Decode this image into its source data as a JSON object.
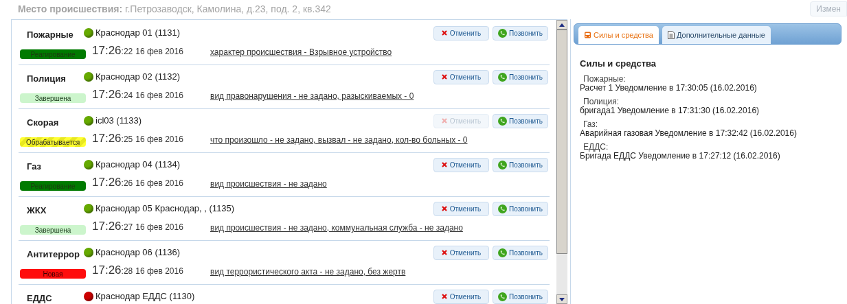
{
  "header": {
    "label": "Место происшествия:",
    "value": "г.Петрозаводск, Камолина, д.23, под. 2, кв.342",
    "button": "Измен"
  },
  "services": [
    {
      "name": "Пожарные",
      "unit": "Краснодар 01 (1131)",
      "color": "#66aa00",
      "status": {
        "kind": "reacting",
        "label": "Реагирование"
      },
      "time": "17:26",
      "seconds": ":22",
      "date": "16 фев 2016",
      "details": "характер происшествия - Взрывное устройство",
      "cancel": {
        "label": "Отменить",
        "disabled": false
      },
      "call": "Позвонить"
    },
    {
      "name": "Полиция",
      "unit": "Краснодар 02 (1132)",
      "color": "#66aa00",
      "status": {
        "kind": "done",
        "label": "Завершена"
      },
      "time": "17:26",
      "seconds": ":24",
      "date": "16 фев 2016",
      "details": "вид правонарушения - не задано, разыскиваемых - 0",
      "cancel": {
        "label": "Отменить",
        "disabled": false
      },
      "call": "Позвонить"
    },
    {
      "name": "Скорая",
      "unit": "icl03 (1133)",
      "color": "#66aa00",
      "status": {
        "kind": "processing",
        "label": "Обрабатывается"
      },
      "time": "17:26",
      "seconds": ":25",
      "date": "16 фев 2016",
      "details": "что произошло - не задано, вызвал - не задано, кол-во больных - 0",
      "cancel": {
        "label": "Отменить",
        "disabled": true
      },
      "call": "Позвонить"
    },
    {
      "name": "Газ",
      "unit": "Краснодар 04 (1134)",
      "color": "#66aa00",
      "status": {
        "kind": "reacting",
        "label": "Реагирование"
      },
      "time": "17:26",
      "seconds": ":26",
      "date": "16 фев 2016",
      "details": "вид происшествия - не задано",
      "cancel": {
        "label": "Отменить",
        "disabled": false
      },
      "call": "Позвонить"
    },
    {
      "name": "ЖКХ",
      "unit": "Краснодар 05 Краснодар, , (1135)",
      "color": "#66aa00",
      "status": {
        "kind": "done",
        "label": "Завершена"
      },
      "time": "17:26",
      "seconds": ":27",
      "date": "16 фев 2016",
      "details": "вид происшествия - не задано, коммунальная служба - не задано",
      "cancel": {
        "label": "Отменить",
        "disabled": false
      },
      "call": "Позвонить"
    },
    {
      "name": "Антитеррор",
      "unit": "Краснодар 06 (1136)",
      "color": "#66aa00",
      "status": {
        "kind": "new",
        "label": "Новая"
      },
      "time": "17:26",
      "seconds": ":28",
      "date": "16 фев 2016",
      "details": "вид террористического акта - не задано, без жертв",
      "cancel": {
        "label": "Отменить",
        "disabled": false
      },
      "call": "Позвонить"
    },
    {
      "name": "ЕДДС",
      "unit": "Краснодар ЕДДС (1130)",
      "color": "#cc0000",
      "cancel": {
        "label": "Отменить",
        "disabled": false
      },
      "call": "Позвонить"
    }
  ],
  "tabs": [
    {
      "label": "Силы и средства",
      "kind": "bus",
      "selected": true
    },
    {
      "label": "Дополнительные данные",
      "kind": "document",
      "selected": false
    }
  ],
  "forces": {
    "title": "Силы и средства",
    "entries": [
      {
        "service": "Пожарные:",
        "text": "Расчет 1 Уведомление в 17:30:05 (16.02.2016)"
      },
      {
        "service": "Полиция:",
        "text": "бригада1 Уведомление в 17:31:30 (16.02.2016)"
      },
      {
        "service": "Газ:",
        "text": "Аварийная газовая Уведомление в 17:32:42 (16.02.2016)"
      },
      {
        "service": "ЕДДС:",
        "text": "Бригада ЕДДС Уведомление в 17:27:12 (16.02.2016)"
      }
    ]
  }
}
